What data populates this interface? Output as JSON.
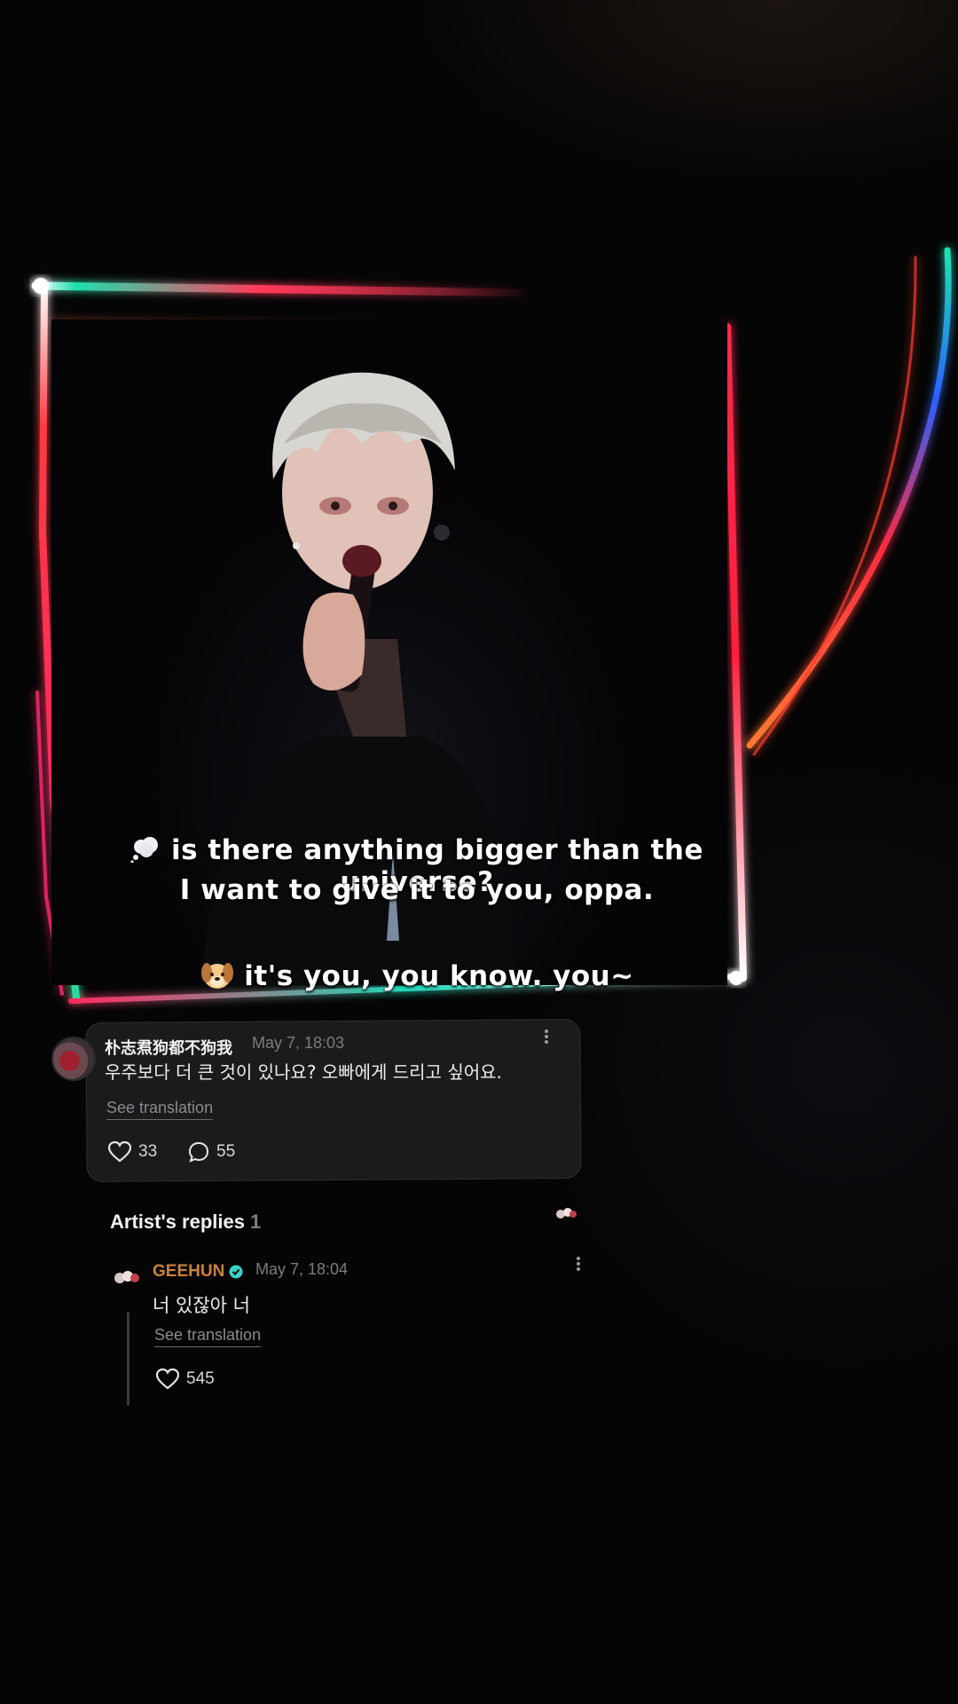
{
  "video": {
    "caption_line_1": "is there anything bigger than the universe?",
    "caption_line_2": "I want to give it to you, oppa.",
    "caption_line_3": "it's you, you know. you~",
    "caption_line_1_icon": "thought-bubble-icon",
    "caption_line_3_icon": "dog-face-icon"
  },
  "comment": {
    "username": "朴志焄狗都不狗我",
    "timestamp": "May 7, 18:03",
    "text": "우주보다 더 큰 것이 있나요? 오빠에게 드리고 싶어요.",
    "see_translation": "See translation",
    "likes": "33",
    "comments": "55"
  },
  "artist_replies": {
    "title": "Artist's replies",
    "count": "1",
    "reply": {
      "username": "GEEHUN",
      "verified": true,
      "timestamp": "May 7, 18:04",
      "text": "너 있잖아 너",
      "see_translation": "See translation",
      "likes": "545"
    }
  },
  "colors": {
    "artist_name": "#c9823a",
    "verified_badge": "#3ad1c6",
    "card_bg": "#1b1b1c"
  }
}
